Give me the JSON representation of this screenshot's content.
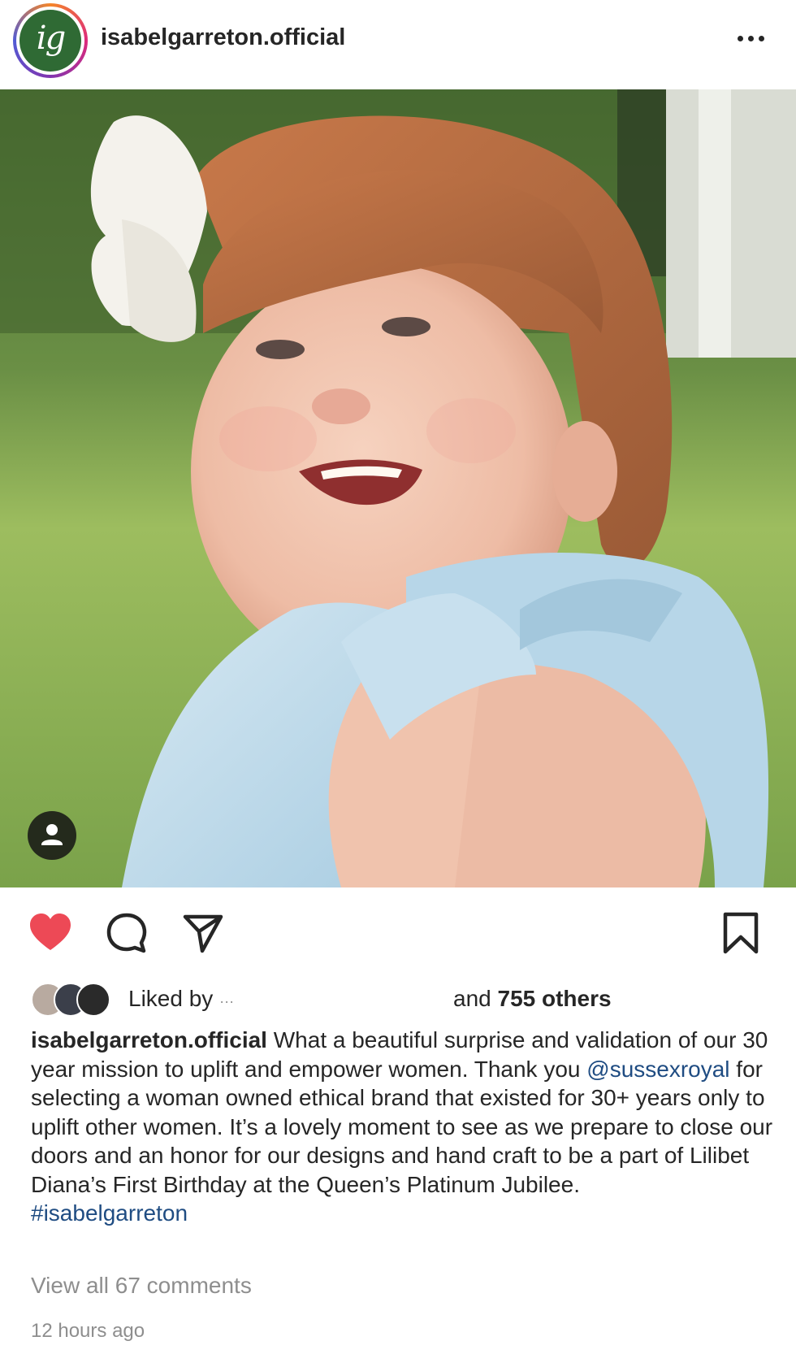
{
  "header": {
    "username": "isabelgarreton.official",
    "avatar_monogram": "ig",
    "more_icon": "more-horizontal-icon"
  },
  "post": {
    "image_description_icon": "baby-photo",
    "tag_icon": "person-tag-icon"
  },
  "actions": {
    "like_icon": "heart-filled-icon",
    "comment_icon": "comment-bubble-icon",
    "share_icon": "paper-plane-icon",
    "save_icon": "bookmark-icon",
    "like_color": "#ed4956"
  },
  "likes": {
    "prefix": "Liked by",
    "redacted": "···",
    "and": "and",
    "others": "755 others"
  },
  "caption": {
    "username": "isabelgarreton.official",
    "text_part1": " What a beautiful surprise and validation of our 30 year mission to uplift and empower women. Thank you ",
    "mention": "@sussexroyal",
    "text_part2": " for selecting a woman owned ethical brand that existed for 30+ years only to uplift other women. It’s a lovely moment to see as we prepare to close our doors and an honor for our designs and hand craft to be a part of  Lilibet Diana’s First Birthday at the Queen’s Platinum Jubilee.",
    "hashtag": "#isabelgarreton"
  },
  "comments": {
    "view_all": "View all 67 comments"
  },
  "timestamp": "12 hours ago",
  "colors": {
    "link": "#1f4c82",
    "muted": "#8e8e8e",
    "text": "#262626"
  }
}
